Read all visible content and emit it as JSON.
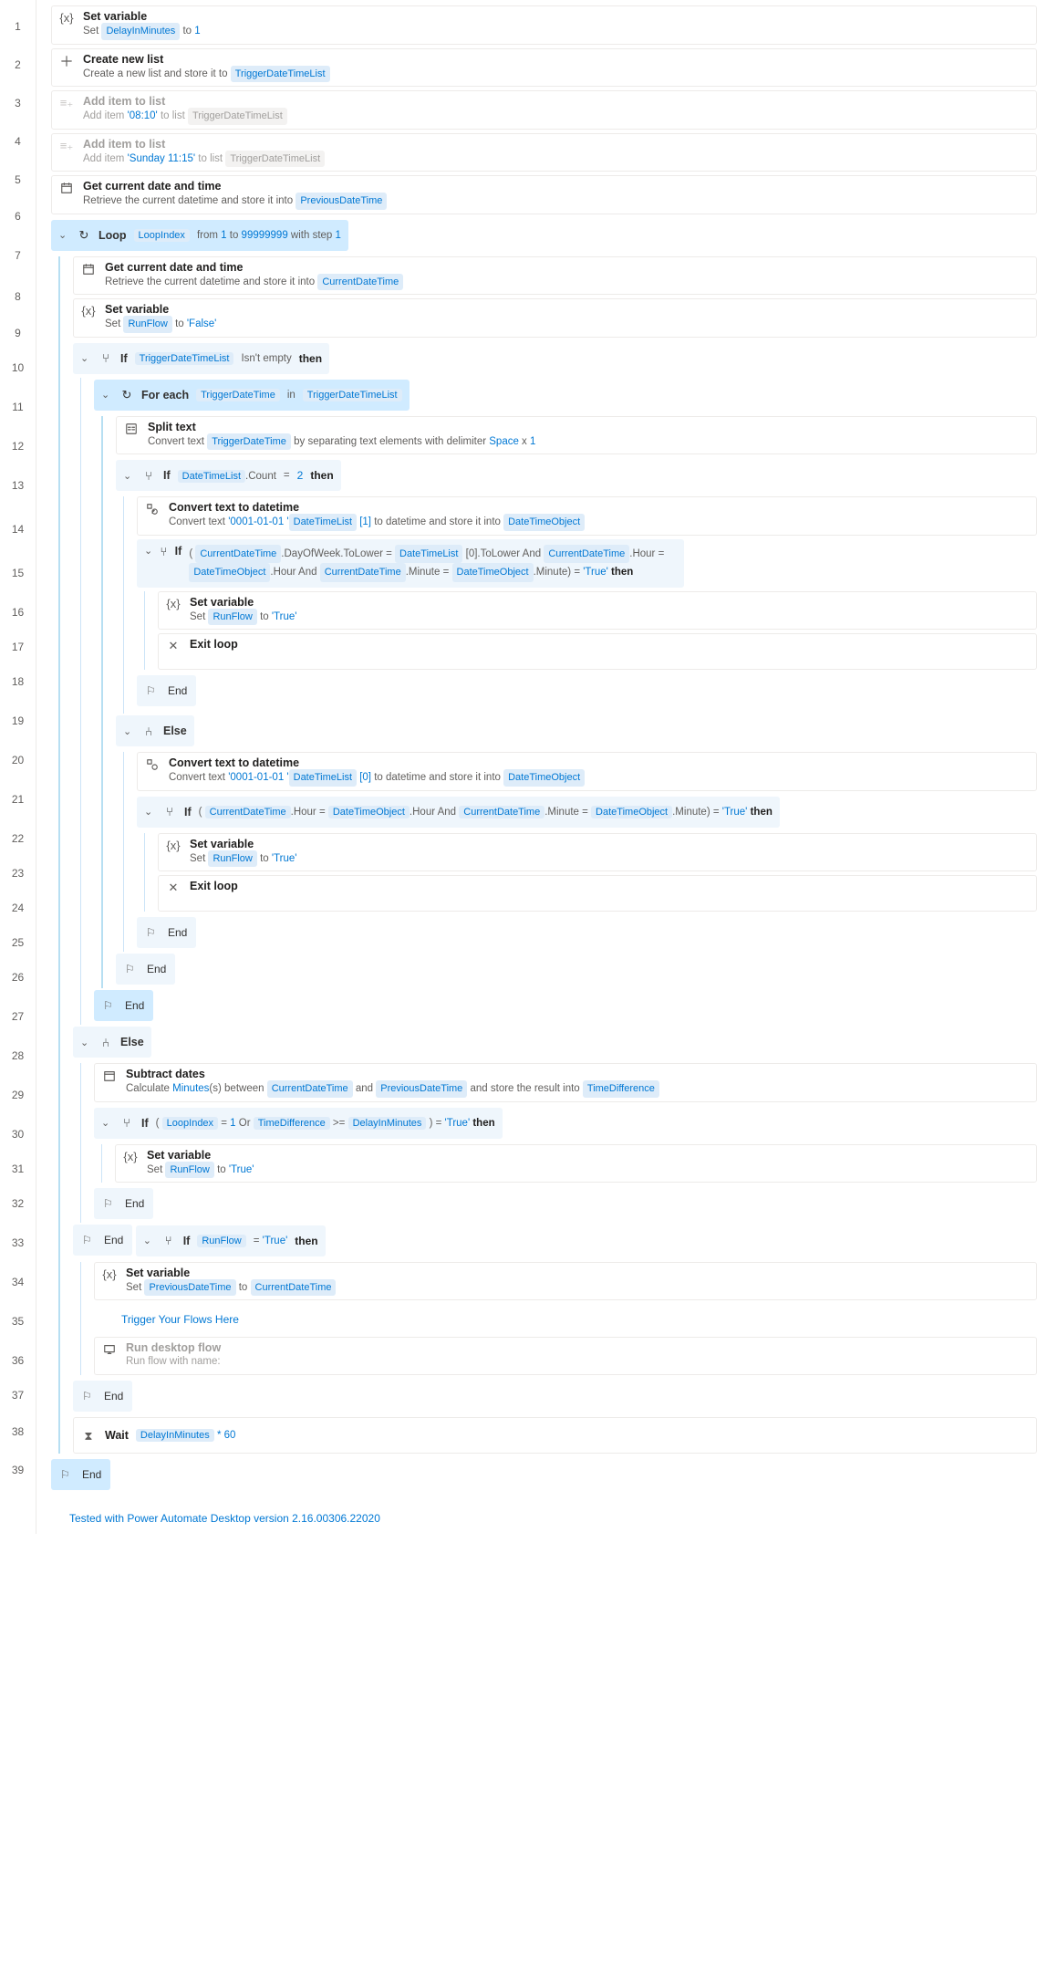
{
  "steps": {
    "s1": {
      "title": "Set variable",
      "pre": "Set ",
      "v": "DelayInMinutes",
      "mid": " to ",
      "val": "1"
    },
    "s2": {
      "title": "Create new list",
      "pre": "Create a new list and store it to ",
      "v": "TriggerDateTimeList"
    },
    "s3": {
      "title": "Add item to list",
      "pre": "Add item ",
      "lit": "'08:10'",
      "mid": " to list ",
      "v": "TriggerDateTimeList"
    },
    "s4": {
      "title": "Add item to list",
      "pre": "Add item ",
      "lit": "'Sunday 11:15'",
      "mid": " to list ",
      "v": "TriggerDateTimeList"
    },
    "s5": {
      "title": "Get current date and time",
      "pre": "Retrieve the current datetime and store it into ",
      "v": "PreviousDateTime"
    },
    "loop": {
      "lbl": "Loop",
      "v": "LoopIndex",
      "t1": "from",
      "l1": "1",
      "t2": "to",
      "l2": "99999999",
      "t3": "with step",
      "l3": "1"
    },
    "s7": {
      "title": "Get current date and time",
      "pre": "Retrieve the current datetime and store it into ",
      "v": "CurrentDateTime"
    },
    "s8": {
      "title": "Set variable",
      "pre": "Set ",
      "v": "RunFlow",
      "mid": " to ",
      "lit": "'False'"
    },
    "if9": {
      "lbl": "If",
      "v": "TriggerDateTimeList",
      "t": " Isn't empty ",
      "kw": "then"
    },
    "fe10": {
      "lbl": "For each",
      "v": "TriggerDateTime",
      "t": "in",
      "v2": "TriggerDateTimeList"
    },
    "s11": {
      "title": "Split text",
      "pre": "Convert text ",
      "v": "TriggerDateTime",
      "mid": " by separating text elements with delimiter ",
      "lit": "Space",
      "mid2": " x ",
      "lit2": "1"
    },
    "if12": {
      "lbl": "If",
      "v": "DateTimeList",
      "prop": ".Count",
      "t": " = ",
      "lit": "2",
      "kw": " then"
    },
    "s13": {
      "title": "Convert text to datetime",
      "pre": "Convert text ",
      "lit": "'0001-01-01 '",
      "v": "DateTimeList",
      "idx": " [1]",
      "mid": " to datetime and store it into ",
      "v2": "DateTimeObject"
    },
    "if14": {
      "lbl": "If",
      "open": "( ",
      "a": {
        "v": "CurrentDateTime",
        "prop": ".DayOfWeek.ToLower"
      },
      "eq1": " = ",
      "b": {
        "v": "DateTimeList",
        "prop": " [0].ToLower"
      },
      "and1": " And ",
      "c": {
        "v": "CurrentDateTime",
        "prop": ".Hour"
      },
      "eq2": " = ",
      "d": {
        "v": "DateTimeObject",
        "prop": ".Hour"
      },
      "and2": " And",
      "e": {
        "v": "CurrentDateTime",
        "prop": ".Minute"
      },
      "eq3": " = ",
      "f": {
        "v": "DateTimeObject",
        "prop": ".Minute"
      },
      "close": ") = ",
      "truelit": "'True'",
      "kw": " then"
    },
    "s15": {
      "title": "Set variable",
      "pre": "Set ",
      "v": "RunFlow",
      "mid": " to ",
      "lit": "'True'"
    },
    "s16": {
      "title": "Exit loop"
    },
    "end17": "End",
    "else18": "Else",
    "s19": {
      "title": "Convert text to datetime",
      "pre": "Convert text ",
      "lit": "'0001-01-01 '",
      "v": "DateTimeList",
      "idx": " [0]",
      "mid": " to datetime and store it into ",
      "v2": "DateTimeObject"
    },
    "if20": {
      "lbl": "If",
      "open": "( ",
      "a": {
        "v": "CurrentDateTime",
        "prop": ".Hour"
      },
      "eq1": " = ",
      "b": {
        "v": "DateTimeObject",
        "prop": ".Hour"
      },
      "and1": " And ",
      "c": {
        "v": "CurrentDateTime",
        "prop": ".Minute"
      },
      "eq2": " = ",
      "d": {
        "v": "DateTimeObject",
        "prop": ".Minute"
      },
      "close": ") = ",
      "truelit": "'True'",
      "kw": " then"
    },
    "s21": {
      "title": "Set variable",
      "pre": "Set ",
      "v": "RunFlow",
      "mid": " to ",
      "lit": "'True'"
    },
    "s22": {
      "title": "Exit loop"
    },
    "end23": "End",
    "end24": "End",
    "end25": "End",
    "else26": "Else",
    "s27": {
      "title": "Subtract dates",
      "pre": "Calculate ",
      "lit": "Minutes",
      "mid": "(s) between ",
      "v": "CurrentDateTime",
      "mid2": " and ",
      "v2": "PreviousDateTime",
      "mid3": " and store the result into ",
      "v3": "TimeDifference"
    },
    "if28": {
      "lbl": "If",
      "open": "( ",
      "a": {
        "v": "LoopIndex"
      },
      "eq1": " = ",
      "lit1": "1",
      "or": " Or ",
      "b": {
        "v": "TimeDifference"
      },
      "ge": " >= ",
      "c": {
        "v": "DelayInMinutes"
      },
      "close": " ) = ",
      "truelit": "'True'",
      "kw": " then"
    },
    "s29": {
      "title": "Set variable",
      "pre": "Set ",
      "v": "RunFlow",
      "mid": " to ",
      "lit": "'True'"
    },
    "end30": "End",
    "end31": "End",
    "if32": {
      "lbl": "If",
      "v": "RunFlow",
      "t": " = ",
      "lit": "'True'",
      "kw": " then"
    },
    "s33": {
      "title": "Set variable",
      "pre": "Set ",
      "v": "PreviousDateTime",
      "mid": " to ",
      "v2": "CurrentDateTime"
    },
    "comment34": "Trigger Your Flows Here",
    "s35": {
      "title": "Run desktop flow",
      "pre": "Run flow with name:"
    },
    "end36": "End",
    "s37": {
      "title": "Wait",
      "v": "DelayInMinutes",
      "lit": " * 60"
    },
    "end38": "End",
    "footnote": "Tested with Power Automate Desktop version 2.16.00306.22020"
  }
}
